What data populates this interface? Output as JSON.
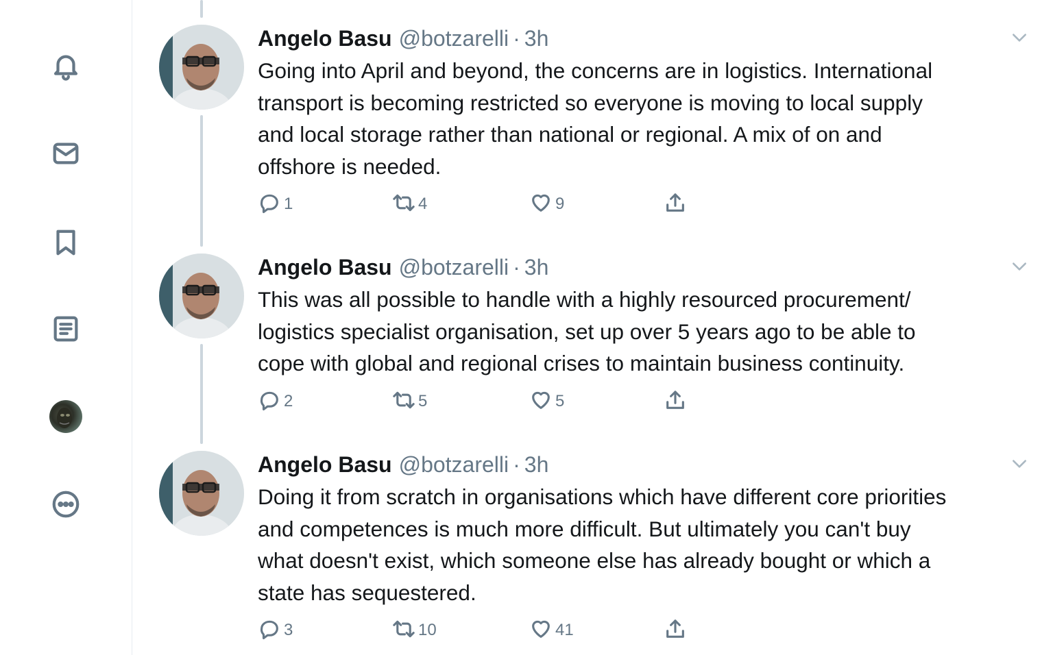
{
  "sidebar": {
    "items": [
      {
        "icon": "bell-icon",
        "label": "Notifications"
      },
      {
        "icon": "mail-icon",
        "label": "Messages"
      },
      {
        "icon": "bookmark-icon",
        "label": "Bookmarks"
      },
      {
        "icon": "list-icon",
        "label": "Lists"
      },
      {
        "icon": "profile-avatar",
        "label": "Profile"
      },
      {
        "icon": "more-icon",
        "label": "More"
      }
    ]
  },
  "colors": {
    "text": "#14171a",
    "secondary": "#657786",
    "thread_line": "#ccd6dd",
    "divider": "#e6ecf0"
  },
  "tweets": [
    {
      "name": "Angelo Basu",
      "handle": "@botzarelli",
      "dot": "·",
      "time": "3h",
      "text": "Going into April and beyond, the concerns are in logistics. International\ntransport is becoming restricted so everyone is moving to local supply\nand local storage rather than national or regional. A mix of on and\noffshore is needed.",
      "replies": "1",
      "retweets": "4",
      "likes": "9"
    },
    {
      "name": "Angelo Basu",
      "handle": "@botzarelli",
      "dot": "·",
      "time": "3h",
      "text": "This was all possible to handle with a highly resourced procurement/\nlogistics specialist organisation, set up over 5 years ago to be able to\ncope with global and regional crises to maintain business continuity.",
      "replies": "2",
      "retweets": "5",
      "likes": "5"
    },
    {
      "name": "Angelo Basu",
      "handle": "@botzarelli",
      "dot": "·",
      "time": "3h",
      "text": "Doing it from scratch in organisations which have different core priorities\nand competences is much more difficult. But ultimately you can't buy\nwhat doesn't exist, which someone else has already bought or which a\nstate has sequestered.",
      "replies": "3",
      "retweets": "10",
      "likes": "41"
    }
  ]
}
